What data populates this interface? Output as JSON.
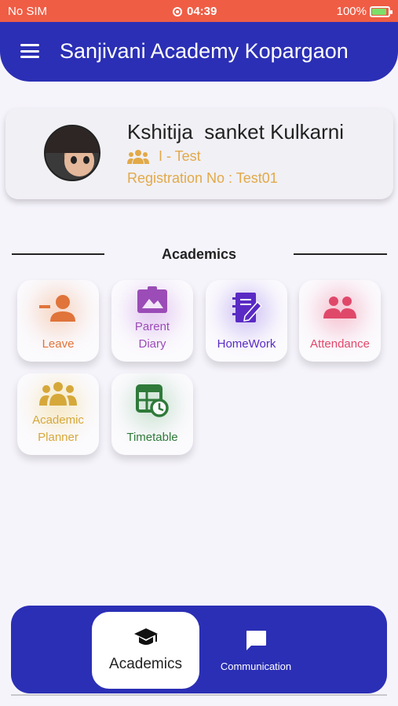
{
  "status_bar": {
    "carrier": "No SIM",
    "time": "04:39",
    "battery": "100%"
  },
  "app_bar": {
    "title": "Sanjivani Academy Kopargaon"
  },
  "profile": {
    "name": "Kshitija  sanket Kulkarni",
    "class_name": "I - Test",
    "registration": "Registration No : Test01"
  },
  "section": {
    "title": "Academics"
  },
  "tiles": [
    {
      "label": "Leave",
      "icon": "leave-icon",
      "color": "#e0743a"
    },
    {
      "label": "Parent\nDiary",
      "icon": "photo-album-icon",
      "color": "#9b4cb7"
    },
    {
      "label": "HomeWork",
      "icon": "homework-icon",
      "color": "#5a2bc4"
    },
    {
      "label": "Attendance",
      "icon": "attendance-icon",
      "color": "#e0486a"
    },
    {
      "label": "Academic\nPlanner",
      "icon": "planner-icon",
      "color": "#d6a83a"
    },
    {
      "label": "Timetable",
      "icon": "timetable-icon",
      "color": "#2f7a3a"
    }
  ],
  "bottom_nav": {
    "items": [
      {
        "label": "Academics",
        "icon": "graduation-cap-icon",
        "active": true
      },
      {
        "label": "Communication",
        "icon": "chat-icon",
        "active": false
      }
    ]
  },
  "colors": {
    "primary": "#2b2fb5",
    "status_bar": "#ef5d45",
    "accent": "#e2a948"
  }
}
